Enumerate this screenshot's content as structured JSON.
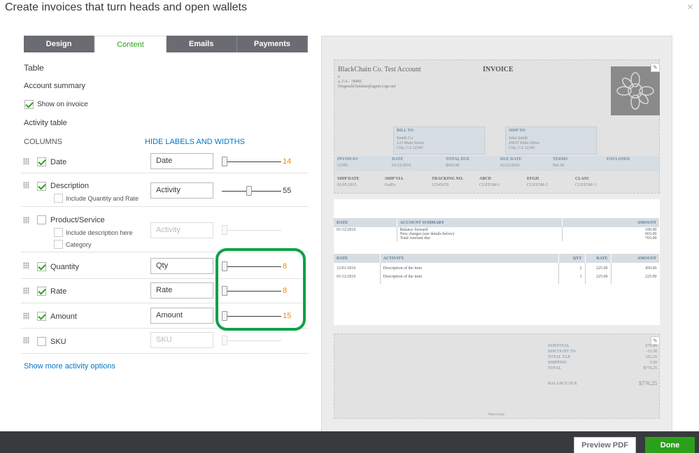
{
  "title": "Create invoices that turn heads and open wallets",
  "close_glyph": "×",
  "tabs": [
    {
      "label": "Design",
      "active": false
    },
    {
      "label": "Content",
      "active": true
    },
    {
      "label": "Emails",
      "active": false
    },
    {
      "label": "Payments",
      "active": false
    }
  ],
  "section_title": "Table",
  "account_summary": {
    "label": "Account summary",
    "show_label": "Show on invoice",
    "checked": true
  },
  "activity_table_label": "Activity table",
  "columns_label": "COLUMNS",
  "hide_labels_link": "HIDE LABELS AND WIDTHS",
  "columns": [
    {
      "name": "Date",
      "checked": true,
      "field": "Date",
      "value": "14",
      "slider_pct": 0.05
    },
    {
      "name": "Description",
      "checked": true,
      "field": "Activity",
      "value": "55",
      "slider_pct": 0.45,
      "sub": "Include Quantity and Rate"
    },
    {
      "name": "Product/Service",
      "checked": false,
      "field": "Activity",
      "sub1": "Include description here",
      "sub2": "Category"
    },
    {
      "name": "Quantity",
      "checked": true,
      "field": "Qty",
      "value": "8",
      "slider_pct": 0.03
    },
    {
      "name": "Rate",
      "checked": true,
      "field": "Rate",
      "value": "8",
      "slider_pct": 0.03
    },
    {
      "name": "Amount",
      "checked": true,
      "field": "Amount",
      "value": "15",
      "slider_pct": 0.03
    },
    {
      "name": "SKU",
      "checked": false,
      "field": "SKU"
    }
  ],
  "show_more_link": "Show more activity options",
  "invoice": {
    "company": "BlackChain Co. Test Account",
    "company_line1": "a",
    "company_line2": "a, CA - 78485",
    "company_line3": "fitzgerald.fudalan@agent.cvgs.net",
    "title": "INVOICE",
    "bill_to_label": "BILL TO",
    "bill_to": [
      "Smith Co.",
      "123 Main Street",
      "City, CA 12345"
    ],
    "ship_to_label": "SHIP TO",
    "ship_to": [
      "John Smith",
      "20637 Palm Drive",
      "City, CA 12345"
    ],
    "meta_headers": [
      "INVOICE#",
      "DATE",
      "TOTAL DUE",
      "DUE DATE",
      "TERMS",
      "ENCLOSED"
    ],
    "meta_values": [
      "12345",
      "01/12/2016",
      "$665.00",
      "02/12/2016",
      "Net 30",
      ""
    ],
    "ship_headers": [
      "SHIP DATE",
      "SHIP VIA",
      "TRACKING NO.",
      "ABCD",
      "EFGH",
      "CLASS"
    ],
    "ship_values": [
      "01/05/2015",
      "FedEx",
      "12345678",
      "CUSTOM-1",
      "CUSTOM-2",
      "CUSTOM-3"
    ],
    "summary_headers": [
      "DATE",
      "ACCOUNT SUMMARY",
      "AMOUNT"
    ],
    "summary_date": "01/12/2016",
    "summary_items": [
      "Balance forward",
      "New charges (see details below)",
      "Total Amount due"
    ],
    "summary_amounts": [
      "100.00",
      "665.00",
      "765.00"
    ],
    "activity_headers": [
      "DATE",
      "ACTIVITY",
      "QTY",
      "RATE",
      "AMOUNT"
    ],
    "activity_rows": [
      [
        "12/01/2016",
        "Description of the item",
        "2",
        "225.00",
        "450.00"
      ],
      [
        "01/12/2016",
        "Description of the item",
        "1",
        "225.00",
        "225.00"
      ]
    ],
    "totals": [
      {
        "label": "SUBTOTAL",
        "value": "675.00"
      },
      {
        "label": "DISCOUNT 2%",
        "value": "-13.50"
      },
      {
        "label": "TOTAL TAX",
        "value": "101.25"
      },
      {
        "label": "SHIPPING",
        "value": "3.50"
      },
      {
        "label": "TOTAL",
        "value": "$776.25"
      }
    ],
    "balance_due_label": "BALANCE DUE",
    "balance_due": "$776.25",
    "footer_note": "Pola Group"
  },
  "buttons": {
    "preview": "Preview PDF",
    "done": "Done"
  },
  "colors": {
    "accent": "#2ca01c",
    "link": "#0077c5",
    "value": "#f28b00",
    "highlight": "#0fa14a"
  }
}
